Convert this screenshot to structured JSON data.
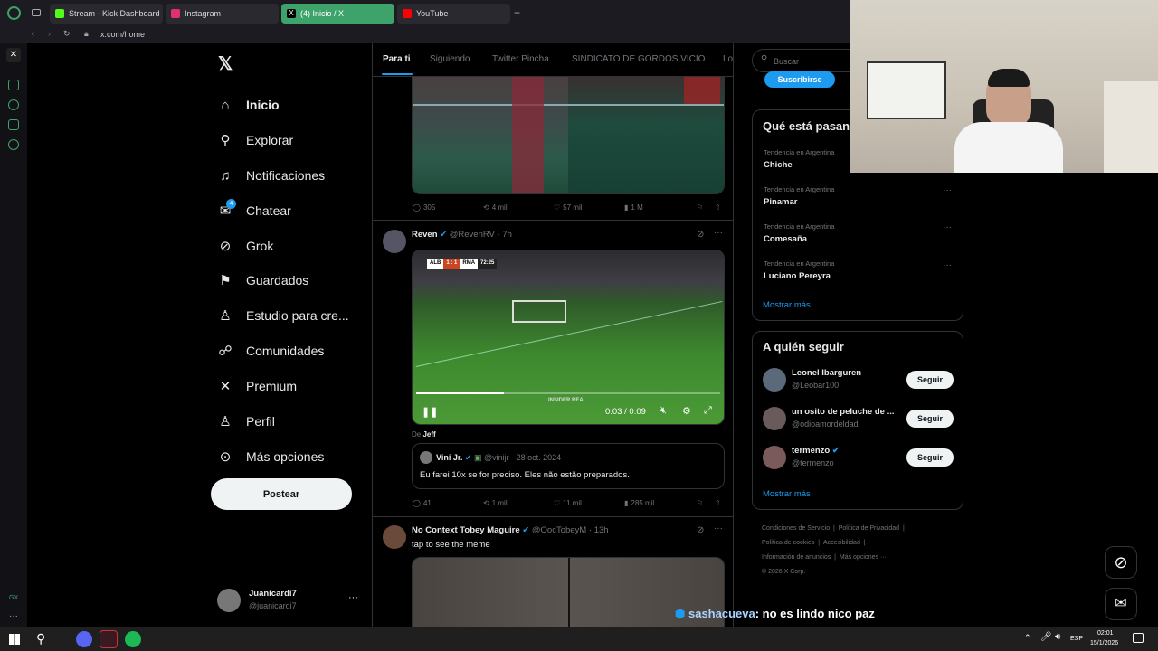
{
  "browser": {
    "tabs": [
      {
        "label": "Stream - Kick Dashboard",
        "color": "#53fc18"
      },
      {
        "label": "Instagram",
        "color": "#e1306c"
      },
      {
        "label": "(4) Inicio / X",
        "color": "#ffffff"
      },
      {
        "label": "YouTube",
        "color": "#ff0000"
      }
    ],
    "url": "x.com/home",
    "accent": "#3ea36a"
  },
  "sidebar": {
    "items": [
      {
        "label": "Inicio",
        "icon": "home-icon",
        "glyph": "⌂"
      },
      {
        "label": "Explorar",
        "icon": "search-icon",
        "glyph": "⚲"
      },
      {
        "label": "Notificaciones",
        "icon": "bell-icon",
        "glyph": "♫"
      },
      {
        "label": "Chatear",
        "icon": "mail-icon",
        "glyph": "✉"
      },
      {
        "label": "Grok",
        "icon": "grok-icon",
        "glyph": "⊘"
      },
      {
        "label": "Guardados",
        "icon": "bookmark-icon",
        "glyph": "⚑"
      },
      {
        "label": "Estudio para cre...",
        "icon": "studio-icon",
        "glyph": "♙"
      },
      {
        "label": "Comunidades",
        "icon": "people-icon",
        "glyph": "☍"
      },
      {
        "label": "Premium",
        "icon": "x-icon",
        "glyph": "✕"
      },
      {
        "label": "Perfil",
        "icon": "person-icon",
        "glyph": "♙"
      },
      {
        "label": "Más opciones",
        "icon": "more-icon",
        "glyph": "⊙"
      }
    ],
    "chat_badge": "4",
    "post_label": "Postear",
    "account": {
      "name": "Juanicardi7",
      "handle": "@juanicardi7"
    }
  },
  "feed": {
    "tabs": [
      "Para ti",
      "Siguiendo",
      "Twitter Pincha",
      "SINDICATO DE GORDOS VICIO",
      "Lo"
    ],
    "post1": {
      "replies": "305",
      "reposts": "4 mil",
      "likes": "57 mil",
      "views": "1 M"
    },
    "post2": {
      "name": "Reven",
      "handle": "@RevenRV",
      "time": "7h",
      "score": {
        "home": "ALB",
        "result": "1 : 1",
        "away": "RMA",
        "clock": "72:25"
      },
      "watermark": "INSIDER REAL",
      "video_time": "0:03 / 0:09",
      "progress": 0.29,
      "from_label": "De",
      "from_name": "Jeff",
      "quote": {
        "name": "Vini Jr.",
        "handle": "@vinijr",
        "date": "28 oct. 2024",
        "text": "Eu farei 10x se for preciso. Eles não estão preparados."
      },
      "replies": "41",
      "reposts": "1 mil",
      "likes": "11 mil",
      "views": "285 mil"
    },
    "post3": {
      "name": "No Context Tobey Maguire",
      "handle": "@OocTobeyM",
      "time": "13h",
      "text": "tap to see the meme"
    }
  },
  "right": {
    "search_placeholder": "Buscar",
    "subscribe_label": "Suscribirse",
    "trends_title": "Qué está pasan",
    "trends": [
      {
        "sub": "Tendencia en Argentina",
        "name": "Chiche"
      },
      {
        "sub": "Tendencia en Argentina",
        "name": "Pinamar"
      },
      {
        "sub": "Tendencia en Argentina",
        "name": "Comesaña"
      },
      {
        "sub": "Tendencia en Argentina",
        "name": "Luciano Pereyra"
      }
    ],
    "show_more": "Mostrar más",
    "follow_title": "A quién seguir",
    "follow": [
      {
        "name": "Leonel Ibarguren",
        "handle": "@Leobar100",
        "button": "Seguir"
      },
      {
        "name": "un osito de peluche de ...",
        "handle": "@odioamordeldad",
        "button": "Seguir"
      },
      {
        "name": "termenzo",
        "handle": "@termenzo",
        "button": "Seguir"
      }
    ],
    "show_more2": "Mostrar más",
    "footer": [
      "Condiciones de Servicio",
      "|",
      "Política de Privacidad",
      "|",
      "Política de cookies",
      "|",
      "Accesibilidad",
      "|",
      "Información de anuncios",
      "|",
      "Más opciones ···",
      "© 2026 X Corp."
    ]
  },
  "chat": {
    "user": "sashacueva",
    "message": ": no es lindo nico paz"
  },
  "taskbar": {
    "lang": "ESP",
    "time": "02:01",
    "date": "15/1/2026"
  }
}
